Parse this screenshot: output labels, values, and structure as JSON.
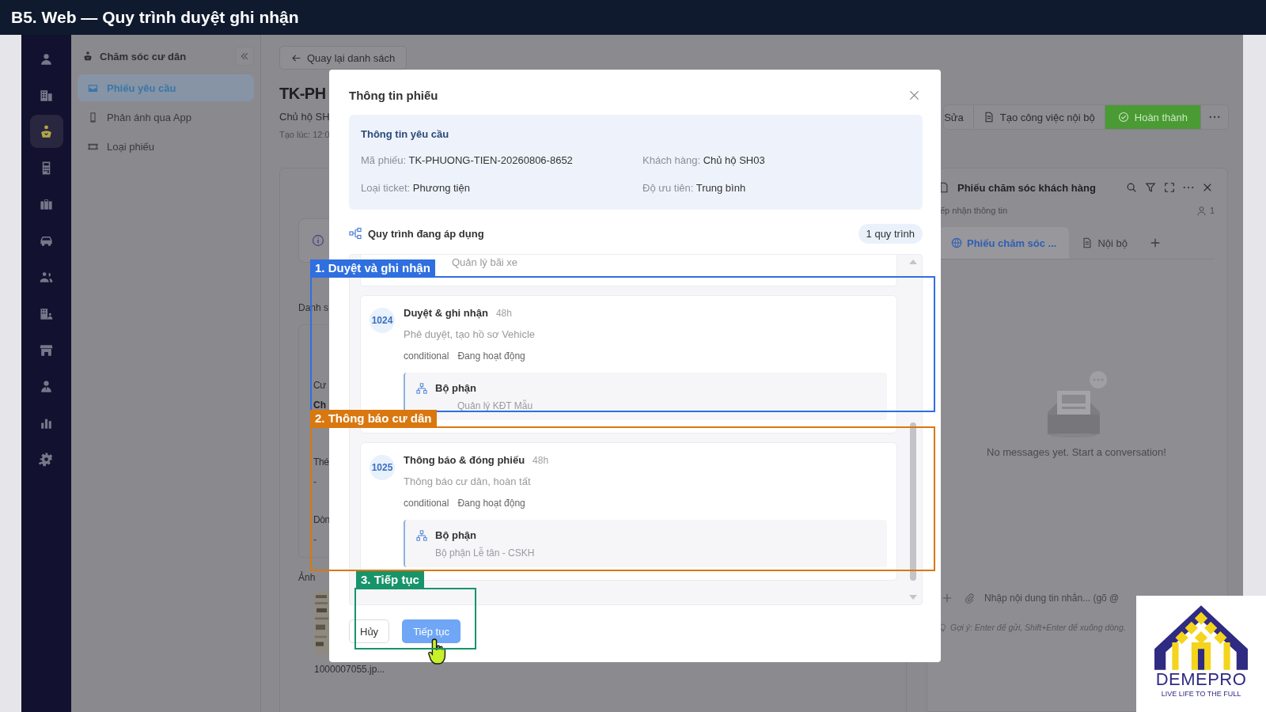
{
  "header": {
    "title": "B5. Web — Quy trình duyệt ghi nhận"
  },
  "rail": [
    {
      "selected": false
    },
    {
      "selected": false
    },
    {
      "selected": true
    },
    {
      "selected": false
    },
    {
      "selected": false
    },
    {
      "selected": false
    },
    {
      "selected": false
    },
    {
      "selected": false
    },
    {
      "selected": false
    },
    {
      "selected": false
    },
    {
      "selected": false
    },
    {
      "selected": false
    }
  ],
  "sidebar": {
    "title": "Chăm sóc cư dân",
    "items": [
      {
        "label": "Phiếu yêu cầu",
        "selected": true
      },
      {
        "label": "Phản ánh qua App",
        "selected": false
      },
      {
        "label": "Loại phiếu",
        "selected": false
      }
    ]
  },
  "page": {
    "back_button": "Quay lại danh sách",
    "title": "TK-PH",
    "subtitle": "Chủ hộ SH",
    "created": "Tạo lúc: 12:0",
    "section_label": "Danh s",
    "fields": [
      {
        "label": "Cư",
        "value": "Ch"
      },
      {
        "label": "Thé",
        "value": "-"
      },
      {
        "label": "Dòn",
        "value": "-"
      }
    ],
    "attachments_label": "Ảnh",
    "attachment": {
      "kind": "picture",
      "filename": "1000007055.jp..."
    }
  },
  "actions": [
    {
      "kind": "plain",
      "label": "Sửa"
    },
    {
      "kind": "document",
      "label": "Tạo công việc nội bộ"
    },
    {
      "kind": "primary",
      "label": "Hoàn thành"
    },
    {
      "kind": "more"
    }
  ],
  "chat": {
    "title": "Phiếu chăm sóc khách hàng",
    "subtitle": "ếp nhận thông tin",
    "member_count": "1",
    "tabs": [
      {
        "label": "Phiếu chăm sóc ...",
        "selected": true
      },
      {
        "label": "Nội bộ",
        "selected": false
      }
    ],
    "empty_text": "No messages yet. Start a conversation!",
    "input": {
      "placeholder": "Nhập nội dung tin nhắn... (gõ @"
    },
    "hint": "Gợi ý: Enter để gửi, Shift+Enter để xuống dòng."
  },
  "modal": {
    "title": "Thông tin phiếu",
    "request": {
      "title": "Thông tin yêu cầu",
      "fields": [
        {
          "label": "Mã phiếu:",
          "value": "TK-PHUONG-TIEN-20260806-8652"
        },
        {
          "label": "Khách hàng:",
          "value": "Chủ hộ SH03"
        },
        {
          "label": "Loại ticket:",
          "value": "Phương tiện"
        },
        {
          "label": "Độ ưu tiên:",
          "value": "Trung bình"
        }
      ]
    },
    "workflow": {
      "title": "Quy trình đang áp dụng",
      "count": "1 quy trình",
      "previous_step_tail": "Quản lý bãi xe",
      "steps": [
        {
          "id": "1024",
          "name": "Duyệt & ghi nhận",
          "duration": "48h",
          "description": "Phê duyệt, tạo hồ sơ Vehicle",
          "type": "conditional",
          "status": "Đang hoạt động",
          "assignee_label": "Bộ phận",
          "assignee": "Quản lý KĐT Mẫu"
        },
        {
          "id": "1025",
          "name": "Thông báo & đóng phiếu",
          "duration": "48h",
          "description": "Thông báo cư dân, hoàn tất",
          "type": "conditional",
          "status": "Đang hoạt động",
          "assignee_label": "Bộ phận",
          "assignee": "Bộ phận Lễ tân - CSKH"
        }
      ]
    },
    "buttons": {
      "cancel": "Hủy",
      "confirm": "Tiếp tục"
    }
  },
  "annotations": [
    {
      "label": "1. Duyệt và ghi nhận",
      "color": "#2f6fe0"
    },
    {
      "label": "2. Thông báo cư dân",
      "color": "#d9780f"
    },
    {
      "label": "3. Tiếp tục",
      "color": "#17946a"
    }
  ],
  "logo": {
    "name": "DEMEPRO",
    "tagline": "LIVE LIFE TO THE FULL"
  }
}
